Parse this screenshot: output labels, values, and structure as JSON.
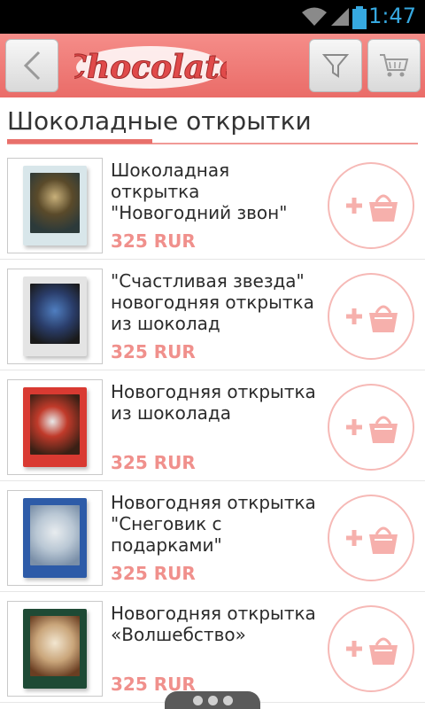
{
  "status_bar": {
    "time": "1:47",
    "icons": [
      "wifi-icon",
      "signal-icon",
      "battery-icon"
    ]
  },
  "app_bar": {
    "logo_text": "Chocolate",
    "back_icon": "chevron-left-icon",
    "filter_icon": "funnel-icon",
    "cart_icon": "shopping-cart-icon"
  },
  "section": {
    "title": "Шоколадные открытки"
  },
  "products": [
    {
      "title": "Шоколадная открытка \"Новогодний звон\"",
      "price": "325 RUR"
    },
    {
      "title": "\"Счастливая звезда\" новогодняя открытка из шоколад",
      "price": "325 RUR"
    },
    {
      "title": "Новогодняя открытка из шоколада",
      "price": "325 RUR"
    },
    {
      "title": "Новогодняя открытка \"Снеговик с подарками\"",
      "price": "325 RUR"
    },
    {
      "title": "Новогодняя открытка «Волшебство»",
      "price": "325 RUR"
    }
  ],
  "colors": {
    "accent": "#ea6c68",
    "price": "#f0908c",
    "add_button": "#f6b9b6"
  }
}
